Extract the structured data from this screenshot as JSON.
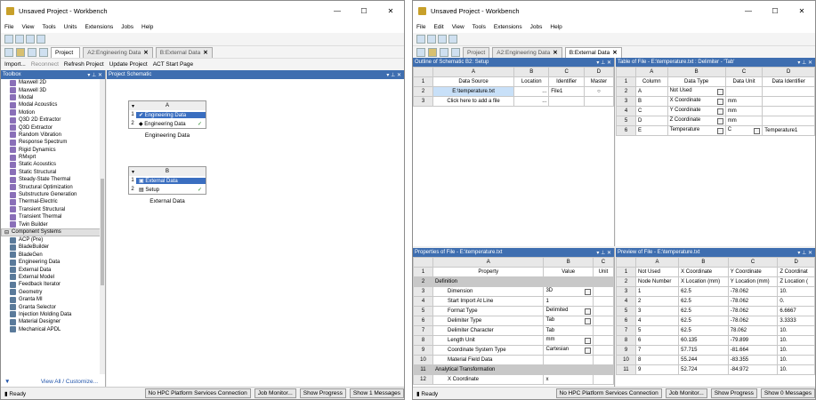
{
  "left": {
    "title": "Unsaved Project - Workbench",
    "menu": [
      "File",
      "View",
      "Tools",
      "Units",
      "Extensions",
      "Jobs",
      "Help"
    ],
    "tabs": [
      {
        "label": "Project",
        "close": ""
      },
      {
        "label": "A2:Engineering Data",
        "close": "✕"
      },
      {
        "label": "B:External Data",
        "close": "✕"
      }
    ],
    "toolbar2": [
      "Import...",
      "Reconnect",
      "Refresh Project",
      "Update Project",
      "ACT Start Page"
    ],
    "toolbox_title": "Toolbox",
    "schematic_title": "Project Schematic",
    "toolbox_items": [
      "Maxwell 2D",
      "Maxwell 3D",
      "Modal",
      "Modal Acoustics",
      "Motion",
      "Q3D 2D Extractor",
      "Q3D Extractor",
      "Random Vibration",
      "Response Spectrum",
      "Rigid Dynamics",
      "RMxprt",
      "Static Acoustics",
      "Static Structural",
      "Steady-State Thermal",
      "Structural Optimization",
      "Substructure Generation",
      "Thermal-Electric",
      "Transient Structural",
      "Transient Thermal",
      "Twin Builder"
    ],
    "component_header": "Component Systems",
    "component_items": [
      "ACP (Pre)",
      "BladeBuilder",
      "BladeGen",
      "Engineering Data",
      "External Data",
      "External Model",
      "Feedback Iterator",
      "Geometry",
      "Granta MI",
      "Granta Selector",
      "Injection Molding Data",
      "Material Designer",
      "Mechanical APDL"
    ],
    "view_all": "View All / Customize...",
    "sysA": {
      "col": "A",
      "rows": [
        {
          "n": "1",
          "label": "Engineering Data"
        },
        {
          "n": "2",
          "label": "Engineering Data",
          "check": "✓"
        }
      ],
      "caption": "Engineering Data"
    },
    "sysB": {
      "col": "B",
      "rows": [
        {
          "n": "1",
          "label": "External Data"
        },
        {
          "n": "2",
          "label": "Setup",
          "check": "✓"
        }
      ],
      "caption": "External Data"
    },
    "status": {
      "ready": "Ready",
      "hpc": "No HPC Platform Services Connection",
      "job": "Job Monitor...",
      "progress": "Show Progress",
      "messages": "Show 1 Messages"
    }
  },
  "right": {
    "title": "Unsaved Project - Workbench",
    "menu": [
      "File",
      "Edit",
      "View",
      "Tools",
      "Extensions",
      "Jobs",
      "Help"
    ],
    "tabs": [
      {
        "label": "Project",
        "close": ""
      },
      {
        "label": "A2:Engineering Data",
        "close": "✕"
      },
      {
        "label": "B:External Data",
        "close": "✕"
      }
    ],
    "outline_title": "Outline of Schematic B2: Setup",
    "outline_cols": [
      "",
      "A",
      "B",
      "C",
      "D"
    ],
    "outline_sub": [
      "",
      "Data Source",
      "Location",
      "Identifier",
      "Master"
    ],
    "outline_rows": [
      [
        "2",
        "E:\\temperature.txt",
        "...",
        "File1",
        "○"
      ],
      [
        "3",
        "Click here to add a file",
        "...",
        "",
        ""
      ]
    ],
    "table_title": "Table of File - E:\\temperature.txt : Delimiter - 'Tab'",
    "table_cols": [
      "",
      "A",
      "B",
      "C",
      "D"
    ],
    "table_sub": [
      "1",
      "Column",
      "Data Type",
      "Data Unit",
      "Data Identifier"
    ],
    "table_rows": [
      [
        "2",
        "A",
        "Not Used",
        "",
        ""
      ],
      [
        "3",
        "B",
        "X Coordinate",
        "mm",
        ""
      ],
      [
        "4",
        "C",
        "Y Coordinate",
        "mm",
        ""
      ],
      [
        "5",
        "D",
        "Z Coordinate",
        "mm",
        ""
      ],
      [
        "6",
        "E",
        "Temperature",
        "C",
        "Temperature1"
      ]
    ],
    "props_title": "Properties of File - E:\\temperature.txt",
    "props_cols": [
      "",
      "A",
      "B",
      "C"
    ],
    "props_sub": [
      "1",
      "Property",
      "Value",
      "Unit"
    ],
    "props_rows": [
      [
        "2",
        "Definition",
        "",
        ""
      ],
      [
        "3",
        "Dimension",
        "3D",
        ""
      ],
      [
        "4",
        "Start Import At Line",
        "1",
        ""
      ],
      [
        "5",
        "Format Type",
        "Delimited",
        ""
      ],
      [
        "6",
        "Delimiter Type",
        "Tab",
        ""
      ],
      [
        "7",
        "Delimiter Character",
        "Tab",
        ""
      ],
      [
        "8",
        "Length Unit",
        "mm",
        ""
      ],
      [
        "9",
        "Coordinate System Type",
        "Cartesian",
        ""
      ],
      [
        "10",
        "Material Field Data",
        "",
        ""
      ],
      [
        "11",
        "Analytical Transformation",
        "",
        ""
      ],
      [
        "12",
        "X Coordinate",
        "x",
        ""
      ]
    ],
    "preview_title": "Preview of File - E:\\temperature.txt",
    "preview_cols": [
      "",
      "A",
      "B",
      "C",
      "D"
    ],
    "preview_rows": [
      [
        "1",
        "Not Used",
        "X Coordinate",
        "Y Coordinate",
        "Z Coordinat"
      ],
      [
        "2",
        "Node Number",
        "X Location (mm)",
        "Y Location (mm)",
        "Z Location ("
      ],
      [
        "3",
        "1",
        "62.5",
        "-78.062",
        "10."
      ],
      [
        "4",
        "2",
        "62.5",
        "-78.062",
        "0."
      ],
      [
        "5",
        "3",
        "62.5",
        "-78.062",
        "6.6667"
      ],
      [
        "6",
        "4",
        "62.5",
        "-78.062",
        "3.3333"
      ],
      [
        "7",
        "5",
        "62.5",
        "78.062",
        "10."
      ],
      [
        "8",
        "6",
        "60.135",
        "-79.899",
        "10."
      ],
      [
        "9",
        "7",
        "57.715",
        "-81.664",
        "10."
      ],
      [
        "10",
        "8",
        "55.244",
        "-83.355",
        "10."
      ],
      [
        "11",
        "9",
        "52.724",
        "-84.972",
        "10."
      ]
    ],
    "status": {
      "ready": "Ready",
      "hpc": "No HPC Platform Services Connection",
      "job": "Job Monitor...",
      "progress": "Show Progress",
      "messages": "Show 0 Messages"
    }
  }
}
